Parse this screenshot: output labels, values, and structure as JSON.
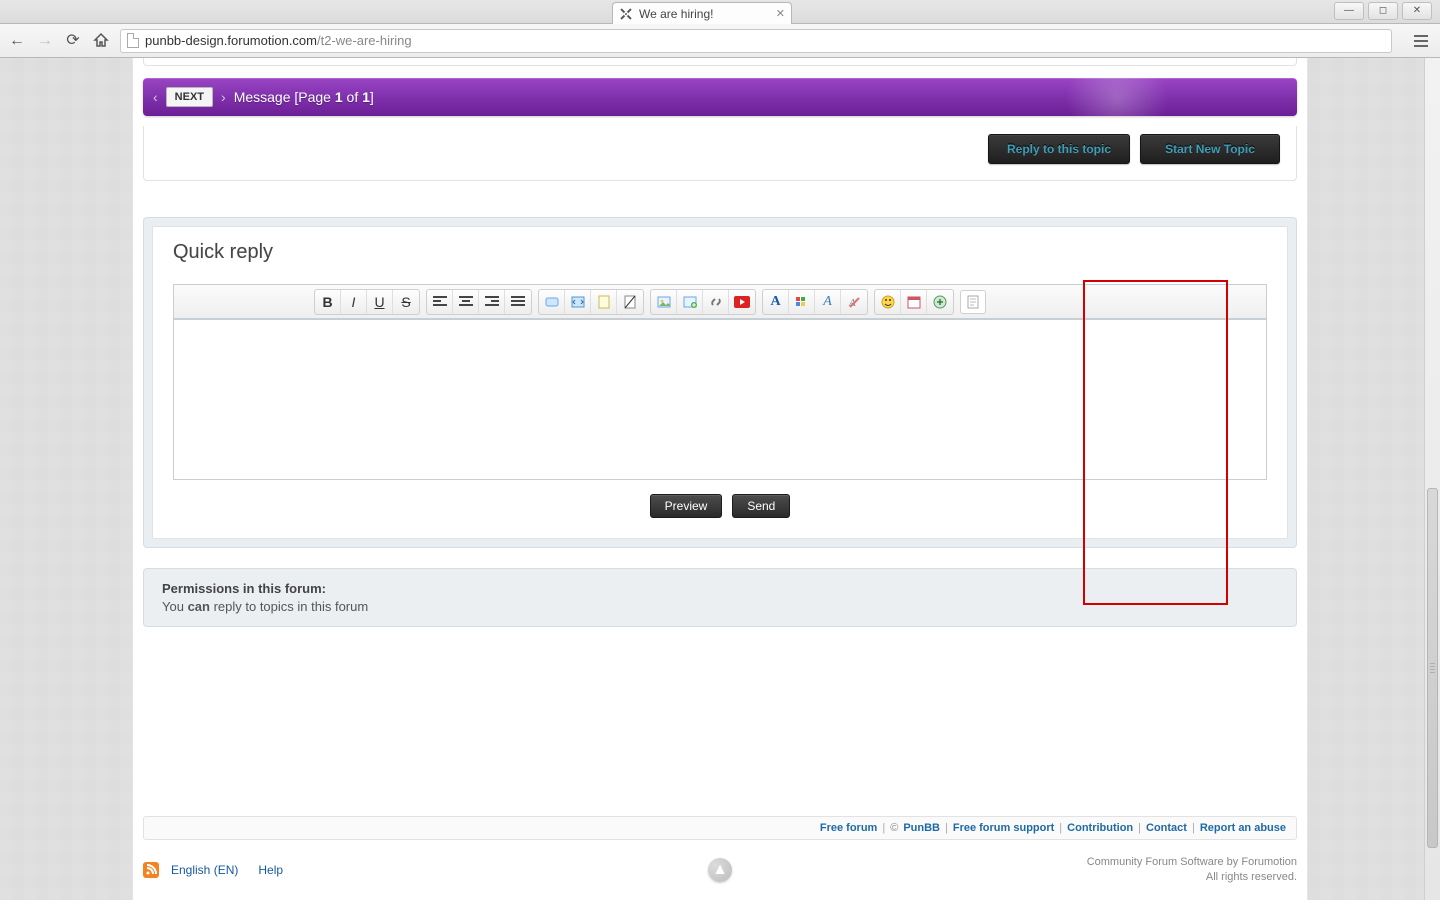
{
  "browser": {
    "tab_title": "We are hiring!",
    "url_domain": "punbb-design.forumotion.com",
    "url_path": "/t2-we-are-hiring"
  },
  "pager": {
    "next_label": "NEXT",
    "message_prefix": "Message [Page ",
    "page_current": "1",
    "page_of": " of ",
    "page_total": "1",
    "message_suffix": "]"
  },
  "actions": {
    "reply_label": "Reply to this topic",
    "new_label": "Start New Topic"
  },
  "quick_reply": {
    "title": "Quick reply",
    "preview_label": "Preview",
    "send_label": "Send"
  },
  "permissions": {
    "heading": "Permissions in this forum:",
    "line_pre": "You ",
    "line_bold": "can",
    "line_post": " reply to topics in this forum"
  },
  "footer": {
    "free_forum": "Free forum",
    "copyright": "©",
    "punbb": "PunBB",
    "support": "Free forum support",
    "contribution": "Contribution",
    "contact": "Contact",
    "report": "Report an abuse"
  },
  "sub": {
    "lang": "English (EN)",
    "help": "Help"
  },
  "credits": {
    "line1": "Community Forum Software by Forumotion",
    "line2": "All rights reserved."
  }
}
